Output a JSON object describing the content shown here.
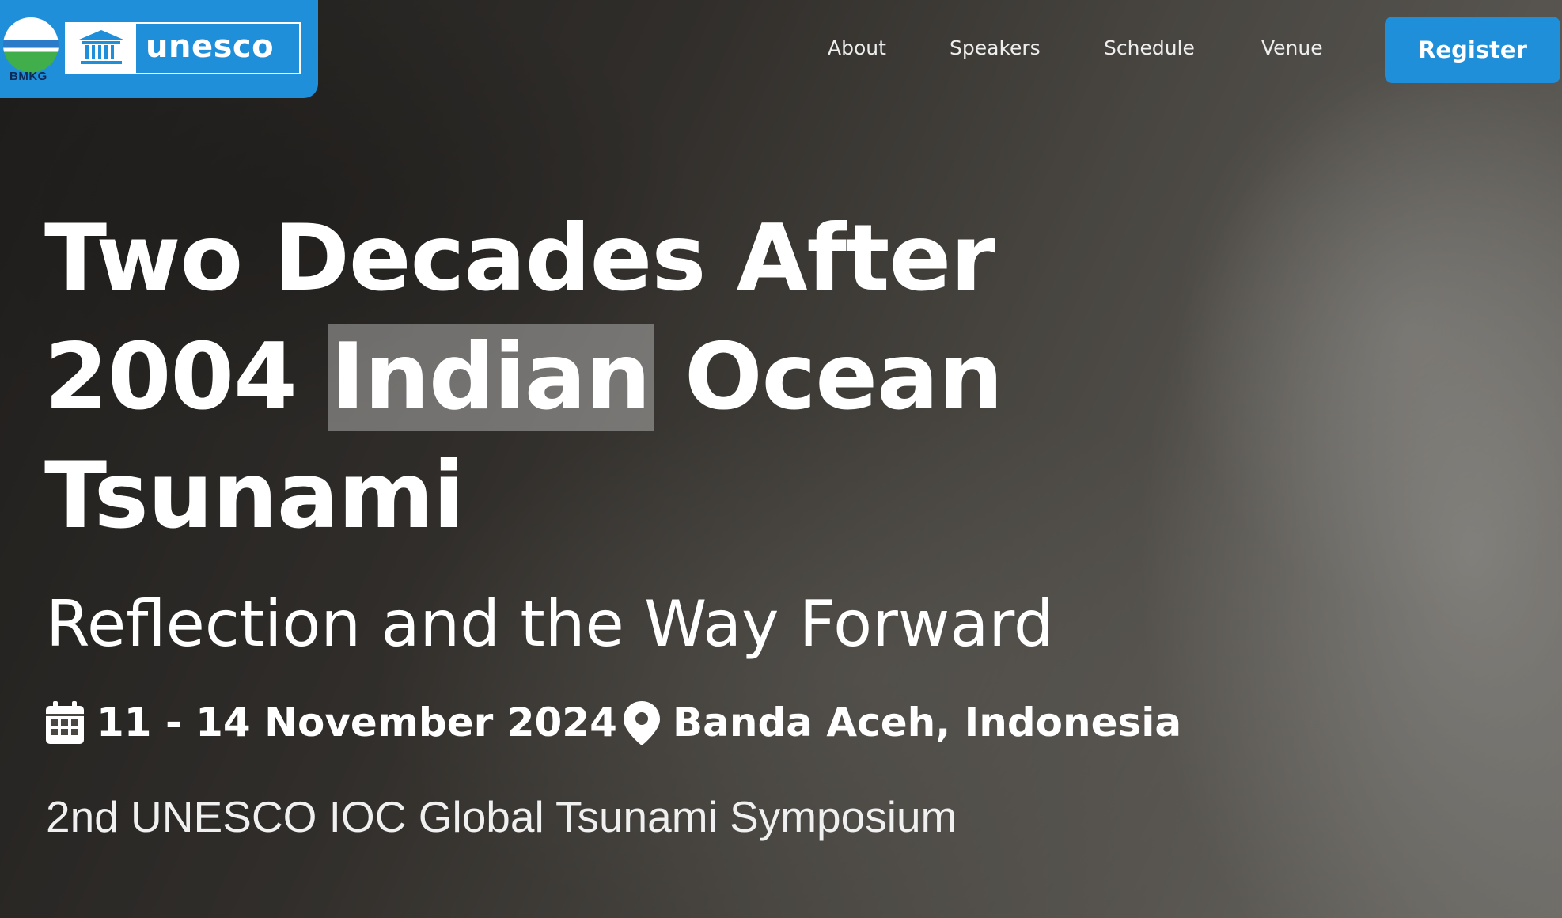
{
  "header": {
    "logos": {
      "bmkg": "BMKG",
      "unesco": "unesco"
    },
    "nav": {
      "about": "About",
      "speakers": "Speakers",
      "schedule": "Schedule",
      "venue": "Venue"
    },
    "register_label": "Register"
  },
  "hero": {
    "title_line1": "Two Decades After",
    "title_line2_pre": "2004 ",
    "title_line2_highlight": "Indian",
    "title_line2_post": " Ocean",
    "title_line3": "Tsunami",
    "subtitle": "Reflection and the Way Forward",
    "date": "11 - 14 November 2024",
    "location": "Banda Aceh, Indonesia",
    "event_name": "2nd UNESCO IOC Global Tsunami Symposium"
  },
  "colors": {
    "accent": "#1f8fda",
    "text": "#ffffff"
  },
  "icons": {
    "date": "calendar-icon",
    "location": "map-pin-icon"
  }
}
